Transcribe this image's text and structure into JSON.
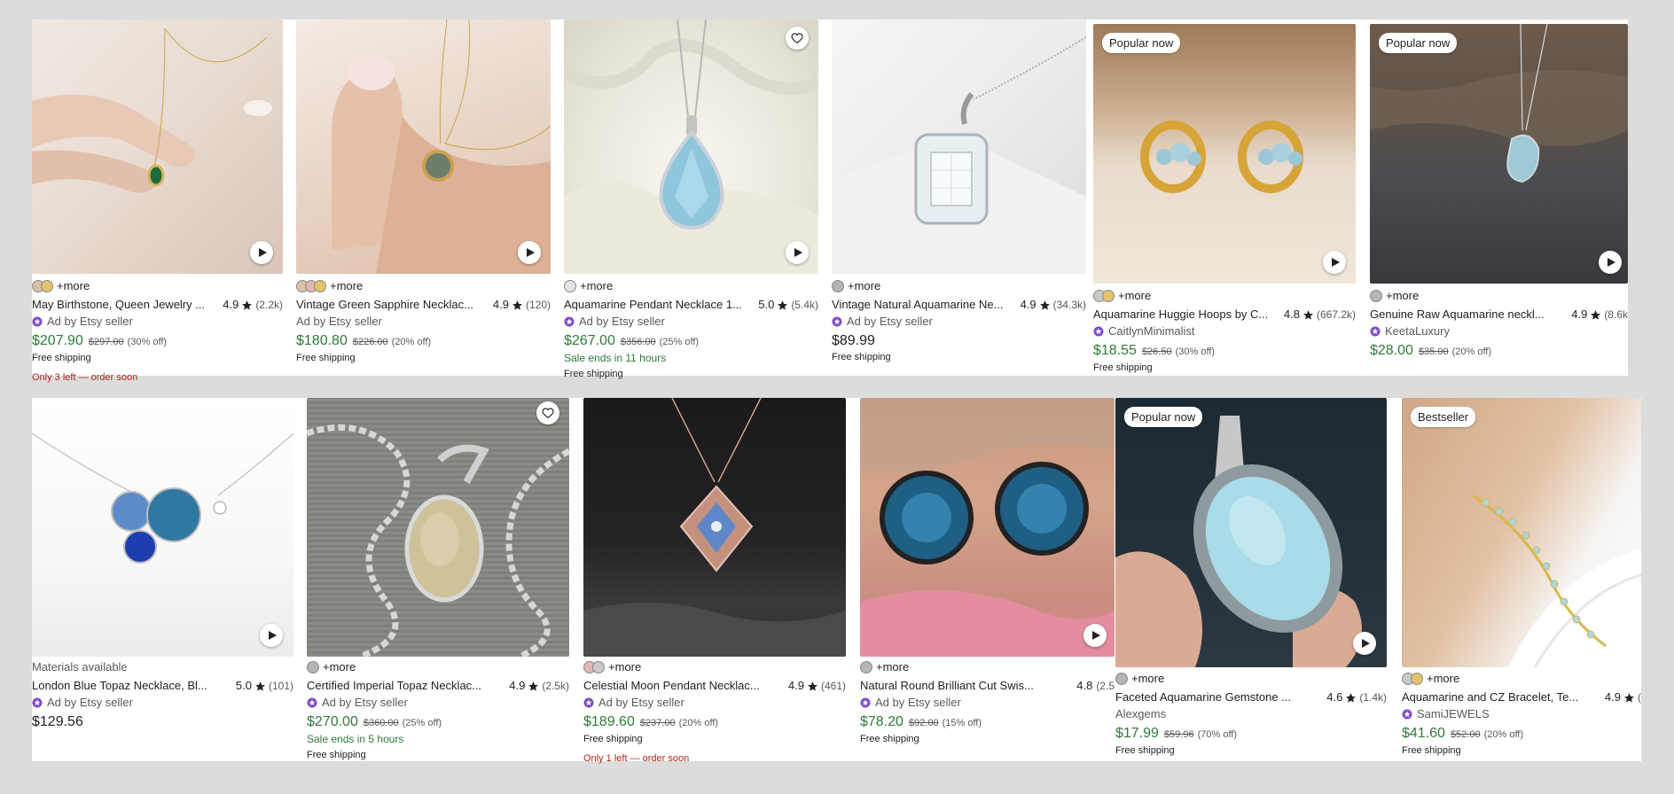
{
  "row1": [
    {
      "title": "May Birthstone, Queen Jewelry ...",
      "rating": "4.9",
      "count": "(2.2k)",
      "seller": "Ad by Etsy seller",
      "star_seller": true,
      "price": "$207.90",
      "orig": "$297.00",
      "off": "(30% off)",
      "extra1": "Free shipping",
      "extra2": "Only 3 left — order soon",
      "more": "+more",
      "swatches": [
        "#d8c3a8",
        "#e3c46a"
      ],
      "play": true
    },
    {
      "title": "Vintage Green Sapphire Necklac...",
      "rating": "4.9",
      "count": "(120)",
      "seller": "Ad by Etsy seller",
      "star_seller": false,
      "price": "$180.80",
      "orig": "$226.00",
      "off": "(20% off)",
      "extra1": "Free shipping",
      "more": "+more",
      "swatches": [
        "#d8c3a8",
        "#e3b6b0",
        "#e3c46a"
      ],
      "play": true
    },
    {
      "title": "Aquamarine Pendant Necklace 1...",
      "rating": "5.0",
      "count": "(5.4k)",
      "seller": "Ad by Etsy seller",
      "star_seller": true,
      "price": "$267.00",
      "orig": "$356.00",
      "off": "(25% off)",
      "sale": "Sale ends in 11 hours",
      "extra1": "Free shipping",
      "more": "+more",
      "swatches": [
        "#e4e4e4"
      ],
      "play": true,
      "fav": true
    },
    {
      "title": "Vintage Natural Aquamarine Ne...",
      "rating": "4.9",
      "count": "(34.3k)",
      "seller": "Ad by Etsy seller",
      "star_seller": true,
      "price": "$89.99",
      "plain": true,
      "extra1": "Free shipping",
      "more": "+more",
      "swatches": [
        "#b5b5b5"
      ]
    },
    {
      "badge": "Popular now",
      "title": "Aquamarine Huggie Hoops by C...",
      "rating": "4.8",
      "count": "(667.2k)",
      "seller": "CaitlynMinimalist",
      "star_seller": true,
      "price": "$18.55",
      "orig": "$26.50",
      "off": "(30% off)",
      "extra1": "Free shipping",
      "more": "+more",
      "swatches": [
        "#c9c9c9",
        "#e3c46a"
      ],
      "play": true
    },
    {
      "badge": "Popular now",
      "title": "Genuine Raw Aquamarine neckl...",
      "rating": "4.9",
      "count": "(8.6k",
      "seller": "KeetaLuxury",
      "star_seller": true,
      "price": "$28.00",
      "orig": "$35.00",
      "off": "(20% off)",
      "more": "+more",
      "swatches": [
        "#b5b5b5"
      ],
      "play": true
    }
  ],
  "row2": [
    {
      "materials": "Materials available",
      "title": "London Blue Topaz Necklace, Bl...",
      "rating": "5.0",
      "count": "(101)",
      "seller": "Ad by Etsy seller",
      "star_seller": true,
      "price": "$129.56",
      "plain": true,
      "play": true
    },
    {
      "title": "Certified Imperial Topaz Necklac...",
      "rating": "4.9",
      "count": "(2.5k)",
      "seller": "Ad by Etsy seller",
      "star_seller": true,
      "price": "$270.00",
      "orig": "$360.00",
      "off": "(25% off)",
      "sale": "Sale ends in 5 hours",
      "extra1": "Free shipping",
      "more": "+more",
      "swatches": [
        "#b5b5b5"
      ],
      "fav": true
    },
    {
      "title": "Celestial Moon Pendant Necklac...",
      "rating": "4.9",
      "count": "(461)",
      "seller": "Ad by Etsy seller",
      "star_seller": true,
      "price": "$189.60",
      "orig": "$237.00",
      "off": "(20% off)",
      "extra1": "Free shipping",
      "extra2": "Only 1 left — order soon",
      "more": "+more",
      "swatches": [
        "#e3b6b0",
        "#c9c9c9"
      ]
    },
    {
      "title": "Natural Round Brilliant Cut Swis...",
      "rating": "4.8",
      "count": "(2.5",
      "seller": "Ad by Etsy seller",
      "star_seller": true,
      "price": "$78.20",
      "orig": "$92.00",
      "off": "(15% off)",
      "extra1": "Free shipping",
      "more": "+more",
      "swatches": [
        "#b5b5b5"
      ],
      "play": true
    },
    {
      "badge": "Popular now",
      "title": "Faceted Aquamarine Gemstone ...",
      "rating": "4.6",
      "count": "(1.4k)",
      "seller": "Alexgems",
      "star_seller": false,
      "price": "$17.99",
      "orig": "$59.96",
      "off": "(70% off)",
      "extra1": "Free shipping",
      "more": "+more",
      "swatches": [
        "#b5b5b5"
      ],
      "play": true
    },
    {
      "badge": "Bestseller",
      "title": "Aquamarine and CZ Bracelet, Te...",
      "rating": "4.9",
      "count": "(",
      "seller": "SamiJEWELS",
      "star_seller": true,
      "price": "$41.60",
      "orig": "$52.00",
      "off": "(20% off)",
      "extra1": "Free shipping",
      "more": "+more",
      "swatches": [
        "#c9c9c9",
        "#e3c46a"
      ]
    }
  ]
}
